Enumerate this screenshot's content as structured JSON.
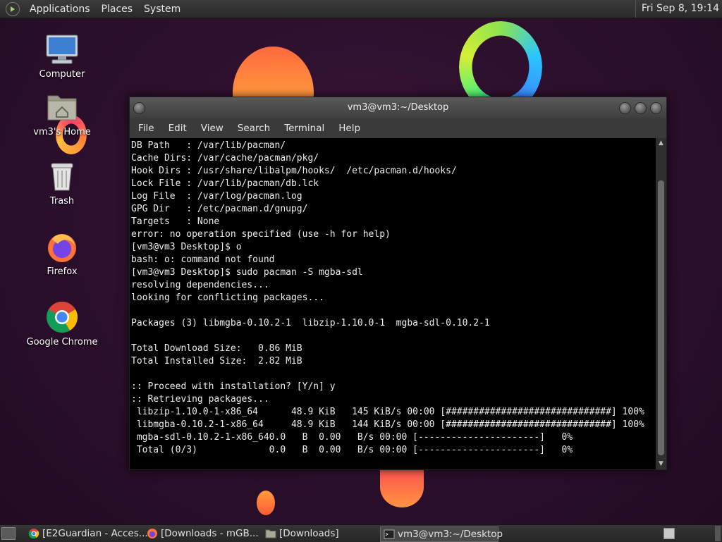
{
  "top_panel": {
    "menus": [
      "Applications",
      "Places",
      "System"
    ],
    "clock": "Fri Sep  8, 19:14"
  },
  "desktop_icons": [
    {
      "label": "Computer",
      "icon": "computer-icon"
    },
    {
      "label": "vm3's Home",
      "icon": "home-folder-icon"
    },
    {
      "label": "Trash",
      "icon": "trash-icon"
    },
    {
      "label": "Firefox",
      "icon": "firefox-icon"
    },
    {
      "label": "Google Chrome",
      "icon": "chrome-icon"
    }
  ],
  "terminal": {
    "title": "vm3@vm3:~/Desktop",
    "menu": [
      "File",
      "Edit",
      "View",
      "Search",
      "Terminal",
      "Help"
    ],
    "lines": [
      "DB Path   : /var/lib/pacman/",
      "Cache Dirs: /var/cache/pacman/pkg/",
      "Hook Dirs : /usr/share/libalpm/hooks/  /etc/pacman.d/hooks/",
      "Lock File : /var/lib/pacman/db.lck",
      "Log File  : /var/log/pacman.log",
      "GPG Dir   : /etc/pacman.d/gnupg/",
      "Targets   : None",
      "error: no operation specified (use -h for help)",
      "[vm3@vm3 Desktop]$ o",
      "bash: o: command not found",
      "[vm3@vm3 Desktop]$ sudo pacman -S mgba-sdl",
      "resolving dependencies...",
      "looking for conflicting packages...",
      "",
      "Packages (3) libmgba-0.10.2-1  libzip-1.10.0-1  mgba-sdl-0.10.2-1",
      "",
      "Total Download Size:   0.86 MiB",
      "Total Installed Size:  2.82 MiB",
      "",
      ":: Proceed with installation? [Y/n] y",
      ":: Retrieving packages...",
      " libzip-1.10.0-1-x86_64      48.9 KiB   145 KiB/s 00:00 [##############################] 100%",
      " libmgba-0.10.2-1-x86_64     48.9 KiB   144 KiB/s 00:00 [##############################] 100%",
      " mgba-sdl-0.10.2-1-x86_640.0   B  0.00   B/s 00:00 [----------------------]   0%",
      " Total (0/3)             0.0   B  0.00   B/s 00:00 [----------------------]   0%"
    ]
  },
  "taskbar": {
    "tasks": [
      {
        "label": "[E2Guardian - Acces...",
        "icon": "chrome-icon",
        "active": false
      },
      {
        "label": "[Downloads - mGB...",
        "icon": "firefox-icon",
        "active": false
      },
      {
        "label": "[Downloads]",
        "icon": "folder-icon",
        "active": false
      },
      {
        "label": "vm3@vm3:~/Desktop",
        "icon": "terminal-icon",
        "active": true
      }
    ]
  },
  "colors": {
    "desktop_bg": "#2b0f2c",
    "terminal_bg": "#000000",
    "terminal_fg": "#ececec",
    "panel_bg": "#2e2e2e"
  }
}
